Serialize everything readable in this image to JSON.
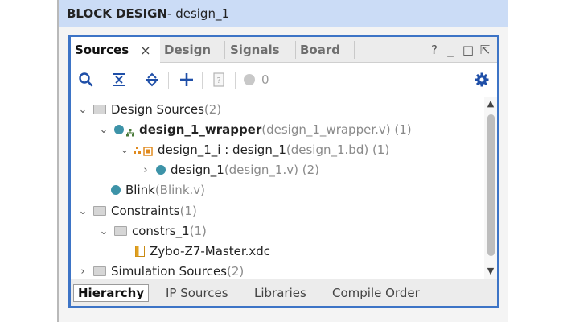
{
  "header": {
    "title_bold": "BLOCK DESIGN",
    "title_rest": " - design_1"
  },
  "tabs": [
    {
      "label": "Sources",
      "active": true,
      "close": "×"
    },
    {
      "label": "Design"
    },
    {
      "label": "Signals"
    },
    {
      "label": "Board"
    }
  ],
  "window_controls": {
    "help": "?",
    "minimize": "_",
    "maximize": "□",
    "float": "⇱"
  },
  "toolbar": {
    "status_count": "0"
  },
  "tree": [
    {
      "label": "Design Sources",
      "detail": " (2)",
      "chevron": "⌄"
    },
    {
      "label": "design_1_wrapper",
      "detail": " (design_1_wrapper.v) (1)",
      "chevron": "⌄"
    },
    {
      "label": "design_1_i : design_1",
      "detail": " (design_1.bd) (1)",
      "chevron": "⌄"
    },
    {
      "label": "design_1",
      "detail": " (design_1.v) (2)",
      "chevron": "›"
    },
    {
      "label": "Blink",
      "detail": " (Blink.v)"
    },
    {
      "label": "Constraints",
      "detail": " (1)",
      "chevron": "⌄"
    },
    {
      "label": "constrs_1",
      "detail": " (1)",
      "chevron": "⌄"
    },
    {
      "label": "Zybo-Z7-Master.xdc",
      "detail": ""
    },
    {
      "label": "Simulation Sources",
      "detail": " (2)",
      "chevron": "›"
    }
  ],
  "bottom_tabs": [
    {
      "label": "Hierarchy",
      "active": true
    },
    {
      "label": "IP Sources"
    },
    {
      "label": "Libraries"
    },
    {
      "label": "Compile Order"
    }
  ],
  "colors": {
    "accent": "#3d74c6",
    "header_bg": "#cbdcf6",
    "module_dot": "#3d93a8",
    "toolbar_icon": "#1f4fa8"
  }
}
